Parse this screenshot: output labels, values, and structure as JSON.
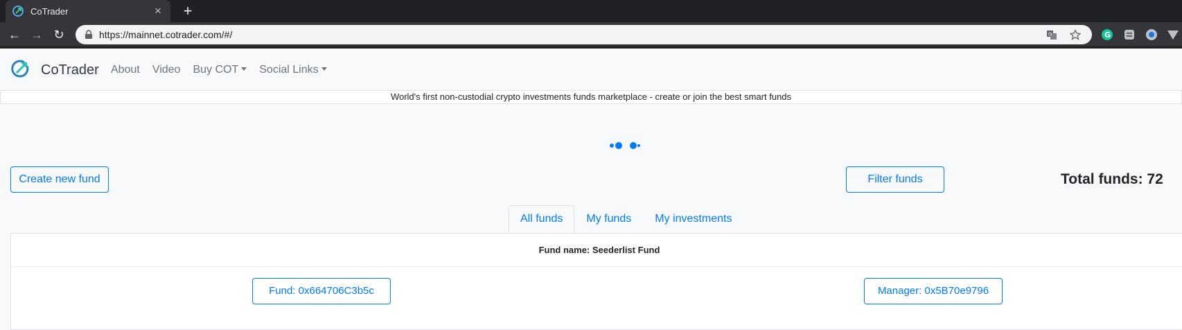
{
  "browser": {
    "tab_title": "CoTrader",
    "tab_close": "×",
    "new_tab": "+",
    "url": "https://mainnet.cotrader.com/#/",
    "back": "←",
    "forward": "→",
    "reload": "↻"
  },
  "navbar": {
    "brand": "CoTrader",
    "links": [
      {
        "label": "About"
      },
      {
        "label": "Video"
      },
      {
        "label": "Buy COT"
      },
      {
        "label": "Social Links"
      }
    ]
  },
  "tagline": "World's first non-custodial crypto investments funds marketplace - create or join the best smart funds",
  "actions": {
    "create_label": "Create new fund",
    "filter_label": "Filter funds",
    "total_label": "Total funds: 72"
  },
  "tabs": [
    {
      "label": "All funds",
      "active": true
    },
    {
      "label": "My funds",
      "active": false
    },
    {
      "label": "My investments",
      "active": false
    }
  ],
  "fund_card": {
    "title": "Fund name: Seederlist Fund",
    "fund_address": "Fund: 0x664706C3b5c",
    "manager_address": "Manager: 0x5B70e9796"
  },
  "colors": {
    "accent": "#007bff",
    "chrome_dark": "#202124",
    "chrome_toolbar": "#35363a"
  }
}
